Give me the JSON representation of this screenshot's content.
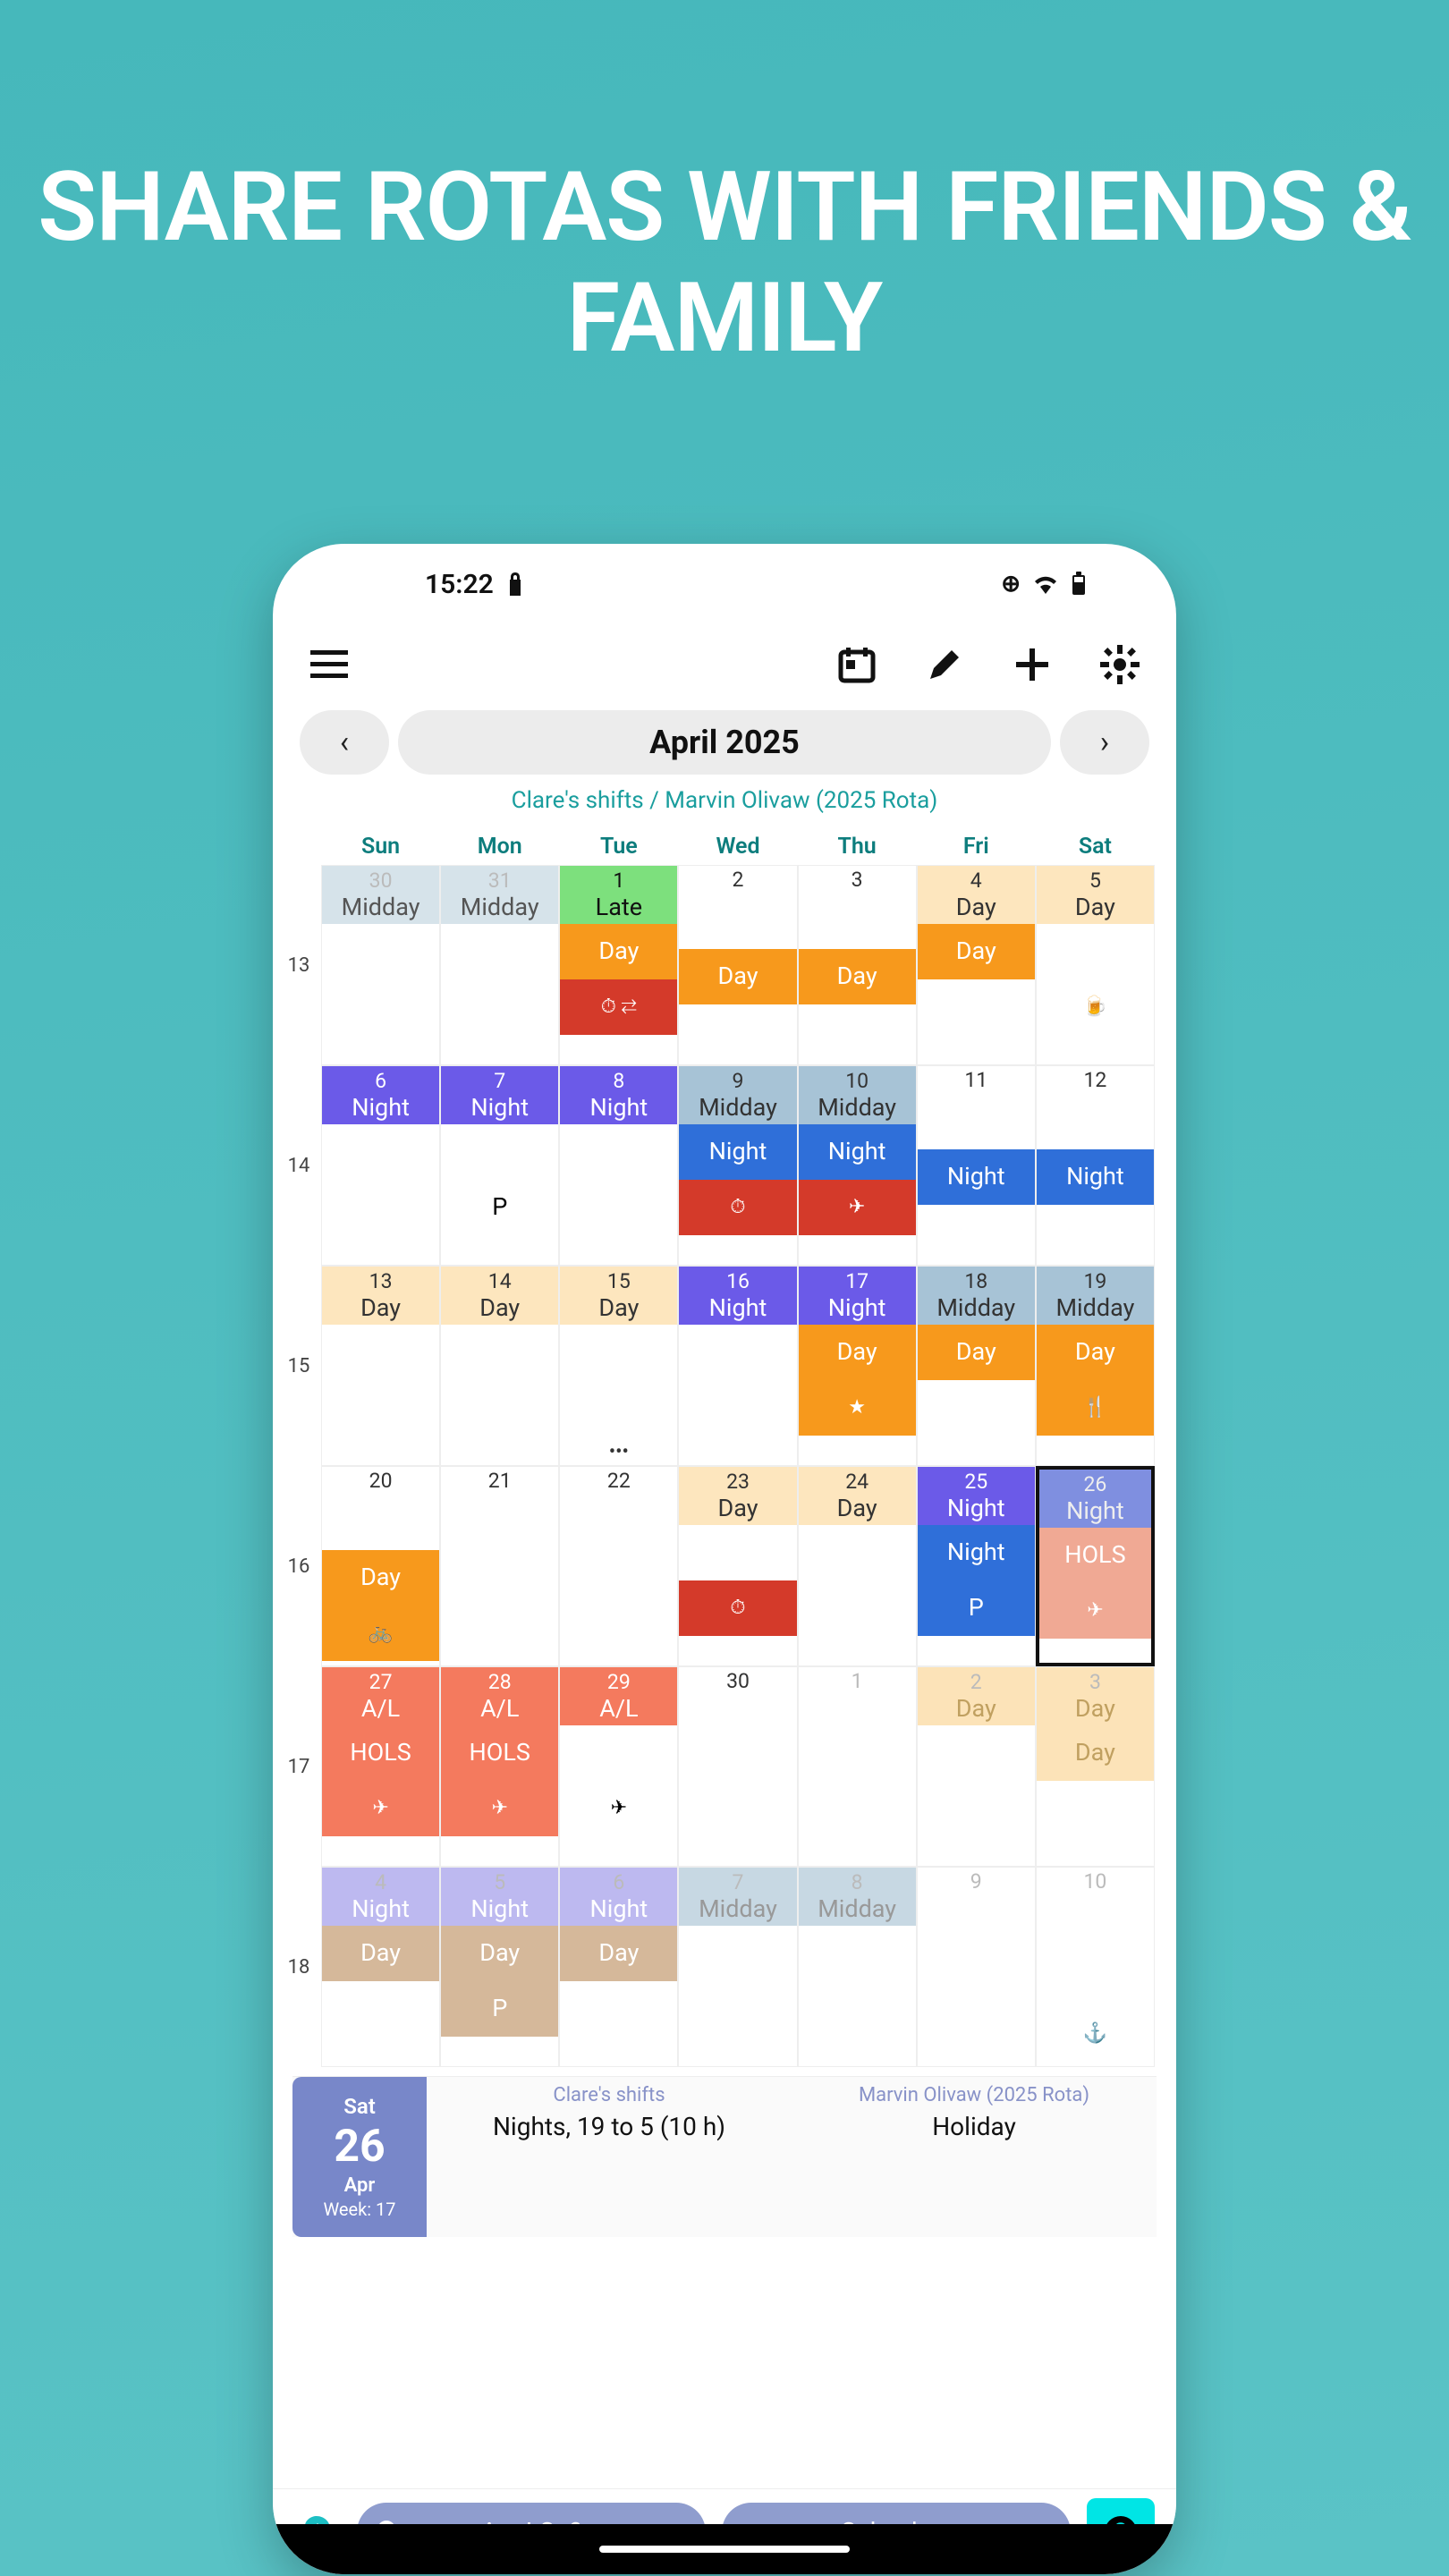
{
  "hero": "SHARE ROTAS WITH FRIENDS & FAMILY",
  "status": {
    "time": "15:22"
  },
  "month_title": "April 2025",
  "subtitle": "Clare's shifts / Marvin Olivaw (2025 Rota)",
  "dow": [
    "Sun",
    "Mon",
    "Tue",
    "Wed",
    "Thu",
    "Fri",
    "Sat"
  ],
  "weeks": [
    {
      "num": "13",
      "days": [
        {
          "n": "30",
          "other": true,
          "blocks": [
            {
              "t": "Midday",
              "c": "c-paleblue",
              "role": "top"
            }
          ]
        },
        {
          "n": "31",
          "other": true,
          "blocks": [
            {
              "t": "Midday",
              "c": "c-paleblue",
              "role": "top"
            }
          ]
        },
        {
          "n": "1",
          "blocks": [
            {
              "t": "Late",
              "c": "c-green",
              "role": "top"
            },
            {
              "t": "Day",
              "c": "c-orange",
              "role": "mid"
            },
            {
              "t": "",
              "c": "c-red",
              "role": "foot",
              "icon": "⏱ ⇄"
            }
          ]
        },
        {
          "n": "2",
          "blocks": [
            {
              "t": "",
              "c": "c-none",
              "role": "top"
            },
            {
              "t": "Day",
              "c": "c-orange",
              "role": "mid"
            }
          ]
        },
        {
          "n": "3",
          "blocks": [
            {
              "t": "",
              "c": "c-none",
              "role": "top"
            },
            {
              "t": "Day",
              "c": "c-orange",
              "role": "mid"
            }
          ]
        },
        {
          "n": "4",
          "blocks": [
            {
              "t": "Day",
              "c": "c-palepeach",
              "role": "top"
            },
            {
              "t": "Day",
              "c": "c-orange",
              "role": "mid"
            }
          ]
        },
        {
          "n": "5",
          "blocks": [
            {
              "t": "Day",
              "c": "c-palepeach",
              "role": "top"
            },
            {
              "t": "",
              "c": "c-none",
              "role": "mid"
            },
            {
              "t": "",
              "c": "c-none",
              "role": "foot",
              "icon": "🍺"
            }
          ]
        }
      ]
    },
    {
      "num": "14",
      "days": [
        {
          "n": "6",
          "blocks": [
            {
              "t": "Night",
              "c": "c-purple",
              "role": "top"
            }
          ]
        },
        {
          "n": "7",
          "blocks": [
            {
              "t": "Night",
              "c": "c-purple",
              "role": "top"
            },
            {
              "t": "",
              "c": "c-none",
              "role": "mid"
            },
            {
              "t": "P",
              "c": "c-none",
              "role": "foot"
            }
          ]
        },
        {
          "n": "8",
          "blocks": [
            {
              "t": "Night",
              "c": "c-purple",
              "role": "top"
            }
          ]
        },
        {
          "n": "9",
          "blocks": [
            {
              "t": "Midday",
              "c": "c-steelblue",
              "role": "top"
            },
            {
              "t": "Night",
              "c": "c-blue",
              "role": "mid"
            },
            {
              "t": "",
              "c": "c-red",
              "role": "foot",
              "icon": "⏱"
            }
          ]
        },
        {
          "n": "10",
          "blocks": [
            {
              "t": "Midday",
              "c": "c-steelblue",
              "role": "top"
            },
            {
              "t": "Night",
              "c": "c-blue",
              "role": "mid"
            },
            {
              "t": "",
              "c": "c-red",
              "role": "foot",
              "icon": "✈"
            }
          ]
        },
        {
          "n": "11",
          "blocks": [
            {
              "t": "",
              "c": "c-none",
              "role": "top"
            },
            {
              "t": "Night",
              "c": "c-blue",
              "role": "mid"
            }
          ]
        },
        {
          "n": "12",
          "blocks": [
            {
              "t": "",
              "c": "c-none",
              "role": "top"
            },
            {
              "t": "Night",
              "c": "c-blue",
              "role": "mid"
            }
          ]
        }
      ]
    },
    {
      "num": "15",
      "days": [
        {
          "n": "13",
          "blocks": [
            {
              "t": "Day",
              "c": "c-palepeach",
              "role": "top"
            }
          ]
        },
        {
          "n": "14",
          "blocks": [
            {
              "t": "Day",
              "c": "c-palepeach",
              "role": "top"
            }
          ]
        },
        {
          "n": "15",
          "blocks": [
            {
              "t": "Day",
              "c": "c-palepeach",
              "role": "top"
            },
            {
              "t": "",
              "c": "c-none",
              "role": "mid"
            }
          ],
          "ellipsis": true
        },
        {
          "n": "16",
          "blocks": [
            {
              "t": "Night",
              "c": "c-purple",
              "role": "top"
            }
          ]
        },
        {
          "n": "17",
          "blocks": [
            {
              "t": "Night",
              "c": "c-purple",
              "role": "top"
            },
            {
              "t": "Day",
              "c": "c-orange",
              "role": "mid"
            },
            {
              "t": "",
              "c": "c-orange",
              "role": "foot",
              "icon": "★"
            }
          ]
        },
        {
          "n": "18",
          "blocks": [
            {
              "t": "Midday",
              "c": "c-steelblue",
              "role": "top"
            },
            {
              "t": "Day",
              "c": "c-orange",
              "role": "mid"
            }
          ]
        },
        {
          "n": "19",
          "blocks": [
            {
              "t": "Midday",
              "c": "c-steelblue",
              "role": "top"
            },
            {
              "t": "Day",
              "c": "c-orange",
              "role": "mid"
            },
            {
              "t": "",
              "c": "c-orange",
              "role": "foot",
              "icon": "🍴"
            }
          ]
        }
      ]
    },
    {
      "num": "16",
      "days": [
        {
          "n": "20",
          "blocks": [
            {
              "t": "",
              "c": "c-none",
              "role": "top"
            },
            {
              "t": "Day",
              "c": "c-orange",
              "role": "mid"
            },
            {
              "t": "",
              "c": "c-orange",
              "role": "foot",
              "icon": "🚲"
            }
          ]
        },
        {
          "n": "21",
          "blocks": []
        },
        {
          "n": "22",
          "blocks": []
        },
        {
          "n": "23",
          "blocks": [
            {
              "t": "Day",
              "c": "c-palepeach",
              "role": "top"
            },
            {
              "t": "",
              "c": "c-none",
              "role": "mid"
            },
            {
              "t": "",
              "c": "c-red",
              "role": "foot",
              "icon": "⏱"
            }
          ]
        },
        {
          "n": "24",
          "blocks": [
            {
              "t": "Day",
              "c": "c-palepeach",
              "role": "top"
            }
          ]
        },
        {
          "n": "25",
          "blocks": [
            {
              "t": "Night",
              "c": "c-purple",
              "role": "top"
            },
            {
              "t": "Night",
              "c": "c-blue",
              "role": "mid"
            },
            {
              "t": "P",
              "c": "c-blue",
              "role": "foot"
            }
          ]
        },
        {
          "n": "26",
          "selected": true,
          "blocks": [
            {
              "t": "Night",
              "c": "c-bluefade",
              "role": "top"
            },
            {
              "t": "HOLS",
              "c": "c-coralfade",
              "role": "mid"
            },
            {
              "t": "",
              "c": "c-coralfade",
              "role": "foot",
              "icon": "✈"
            }
          ]
        }
      ]
    },
    {
      "num": "17",
      "days": [
        {
          "n": "27",
          "blocks": [
            {
              "t": "A/L",
              "c": "c-coral",
              "role": "top"
            },
            {
              "t": "HOLS",
              "c": "c-coral",
              "role": "mid"
            },
            {
              "t": "",
              "c": "c-coral",
              "role": "foot",
              "icon": "✈"
            }
          ]
        },
        {
          "n": "28",
          "blocks": [
            {
              "t": "A/L",
              "c": "c-coral",
              "role": "top"
            },
            {
              "t": "HOLS",
              "c": "c-coral",
              "role": "mid"
            },
            {
              "t": "",
              "c": "c-coral",
              "role": "foot",
              "icon": "✈"
            }
          ]
        },
        {
          "n": "29",
          "blocks": [
            {
              "t": "A/L",
              "c": "c-coral",
              "role": "top"
            },
            {
              "t": "",
              "c": "c-none",
              "role": "mid"
            },
            {
              "t": "",
              "c": "c-none",
              "role": "foot",
              "icon": "✈"
            }
          ]
        },
        {
          "n": "30",
          "blocks": []
        },
        {
          "n": "1",
          "other": true,
          "blocks": []
        },
        {
          "n": "2",
          "other": true,
          "blocks": [
            {
              "t": "Day",
              "c": "c-palepeach2",
              "role": "top"
            }
          ]
        },
        {
          "n": "3",
          "other": true,
          "blocks": [
            {
              "t": "Day",
              "c": "c-palepeach2",
              "role": "top"
            },
            {
              "t": "Day",
              "c": "c-palepeach2",
              "role": "mid"
            }
          ]
        }
      ]
    },
    {
      "num": "18",
      "days": [
        {
          "n": "4",
          "other": true,
          "blocks": [
            {
              "t": "Night",
              "c": "c-lav",
              "role": "top"
            },
            {
              "t": "Day",
              "c": "c-tan",
              "role": "mid"
            }
          ]
        },
        {
          "n": "5",
          "other": true,
          "blocks": [
            {
              "t": "Night",
              "c": "c-lav",
              "role": "top"
            },
            {
              "t": "Day",
              "c": "c-tan",
              "role": "mid"
            },
            {
              "t": "P",
              "c": "c-tan",
              "role": "foot"
            }
          ]
        },
        {
          "n": "6",
          "other": true,
          "blocks": [
            {
              "t": "Night",
              "c": "c-lav",
              "role": "top"
            },
            {
              "t": "Day",
              "c": "c-tan",
              "role": "mid"
            }
          ]
        },
        {
          "n": "7",
          "other": true,
          "blocks": [
            {
              "t": "Midday",
              "c": "c-steelfade",
              "role": "top"
            }
          ]
        },
        {
          "n": "8",
          "other": true,
          "blocks": [
            {
              "t": "Midday",
              "c": "c-steelfade",
              "role": "top"
            }
          ]
        },
        {
          "n": "9",
          "other": true,
          "blocks": []
        },
        {
          "n": "10",
          "other": true,
          "blocks": [
            {
              "t": "",
              "c": "c-none",
              "role": "top"
            },
            {
              "t": "",
              "c": "c-none",
              "role": "mid"
            },
            {
              "t": "",
              "c": "c-none",
              "role": "foot",
              "icon": "⚓"
            }
          ]
        }
      ]
    }
  ],
  "detail": {
    "dayname": "Sat",
    "daynum": "26",
    "month": "Apr",
    "week": "Week: 17",
    "col1_header": "Clare's shifts",
    "col1_body": "Nights, 19 to 5 (10 h)",
    "col2_header": "Marvin Olivaw (2025 Rota)",
    "col2_body": "Holiday"
  },
  "bottom": {
    "pill1": "Am I On?",
    "pill2": "Calendars"
  }
}
